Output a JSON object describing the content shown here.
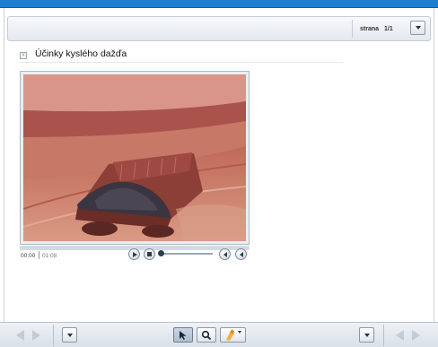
{
  "header": {
    "page_label": "strana",
    "page_number": "1/1"
  },
  "content": {
    "title": "Účinky kyslého dažďa"
  },
  "player": {
    "current_time": "00:00",
    "total_time": "01:08",
    "progress": 0,
    "volume": 0
  },
  "icons": {
    "collapse": "collapse-icon",
    "play": "play-icon",
    "stop": "stop-icon",
    "volume_down": "volume-down-icon",
    "volume_up": "volume-up-icon",
    "pointer": "pointer-icon",
    "zoom": "magnifier-icon",
    "highlighter": "highlighter-icon"
  },
  "colors": {
    "accent_bar": "#1e7fd0",
    "frame_border": "#c3cdd8"
  }
}
